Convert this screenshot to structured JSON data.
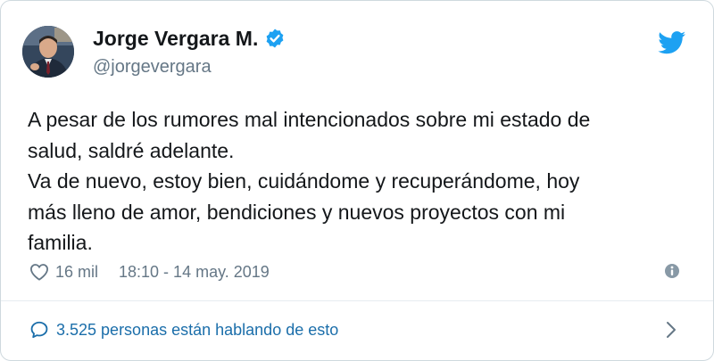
{
  "author": {
    "display_name": "Jorge Vergara M.",
    "handle": "@jorgevergara",
    "verified": true
  },
  "tweet": {
    "lines": [
      "A pesar de los rumores mal intencionados sobre mi estado de",
      "salud, saldré adelante.",
      "Va de nuevo, estoy bien, cuidándome y recuperándome, hoy",
      "más lleno de amor, bendiciones y nuevos proyectos con mi",
      "familia."
    ]
  },
  "meta": {
    "likes": "16 mil",
    "timestamp": "18:10 - 14 may. 2019"
  },
  "conversation": {
    "label": "3.525 personas están hablando de esto"
  },
  "icons": {
    "avatar": "avatar-photo",
    "verified": "verified-badge-icon",
    "logo": "twitter-bird-icon",
    "like": "heart-icon",
    "info": "info-icon",
    "reply": "speech-bubble-icon",
    "more": "chevron-right-icon"
  },
  "colors": {
    "text": "#14171a",
    "secondary": "#657786",
    "brand": "#1da1f2",
    "link": "#1b6eaa",
    "border": "#cfd9de"
  }
}
